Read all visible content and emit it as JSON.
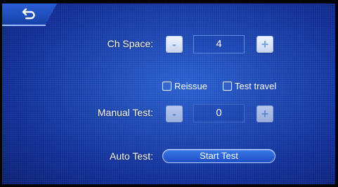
{
  "header": {
    "back_icon": "back-arrow-icon"
  },
  "ch_space": {
    "label": "Ch Space:",
    "minus": "-",
    "value": "4",
    "plus": "+"
  },
  "options": {
    "reissue_label": "Reissue",
    "reissue_checked": false,
    "test_travel_label": "Test travel",
    "test_travel_checked": false
  },
  "manual_test": {
    "label": "Manual Test:",
    "minus": "-",
    "value": "0",
    "plus": "+"
  },
  "auto_test": {
    "label": "Auto Test:",
    "button_label": "Start Test"
  },
  "colors": {
    "background": "#1d47b0",
    "accent": "#3b78e8",
    "text": "#ffffff"
  }
}
